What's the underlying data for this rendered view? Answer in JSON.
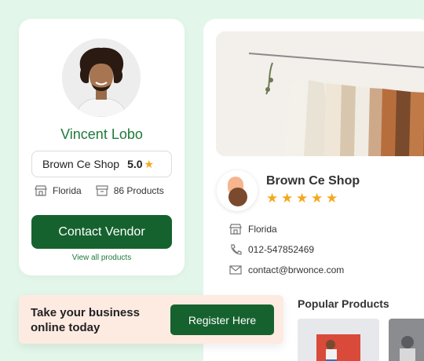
{
  "vendor": {
    "name": "Vincent Lobo",
    "shop_name": "Brown Ce Shop",
    "rating": "5.0",
    "location": "Florida",
    "products_count": "86 Products",
    "contact_label": "Contact Vendor",
    "view_all_label": "View all products"
  },
  "promo": {
    "text": "Take your business online today",
    "button_label": "Register Here"
  },
  "shop": {
    "title": "Brown Ce Shop",
    "stars": 5,
    "location": "Florida",
    "phone": "012-547852469",
    "email": "contact@brwonce.com",
    "popular_title": "Popular Products"
  },
  "colors": {
    "background": "#e3f6ea",
    "primary_green": "#16622e",
    "name_green": "#1f7a3a",
    "star": "#f4a81c",
    "promo_bg": "#fdebe2"
  }
}
